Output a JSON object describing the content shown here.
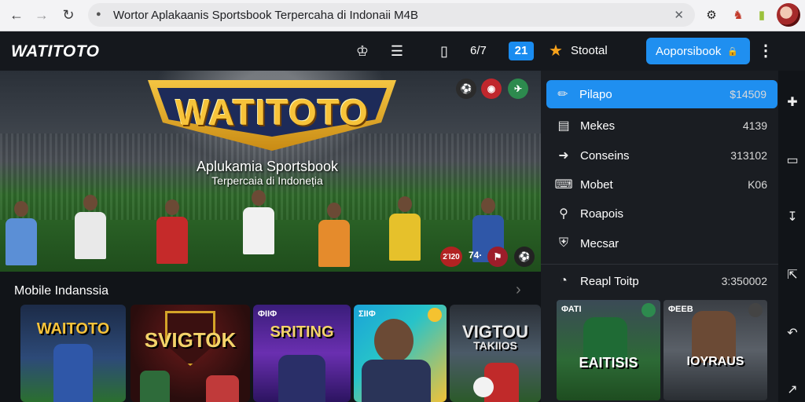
{
  "browser": {
    "url": "Wortor Aplakaanis Sportsbook Terpercaha di Indonaii M4B"
  },
  "header": {
    "brand": "WATITOTO",
    "counter": "6/7",
    "badge": "21",
    "stotal_label": "Stootal",
    "main_button_label": "Aoporsibook"
  },
  "hero": {
    "logo_text": "WATITOTO",
    "subtitle": "Aplukamia Sportsbook",
    "subtitle2": "Terpercaia di Indoneția",
    "score_left": "2Ί20",
    "score_right": "74·"
  },
  "section": {
    "title": "Mobile Indanssia"
  },
  "cards": [
    {
      "title": "WAITOTO"
    },
    {
      "title": "SVIGTOK"
    },
    {
      "title": "SRITING",
      "tag": "ΦΙΙΦ"
    },
    {
      "title": "",
      "tag": "ΣΙΙΦ"
    },
    {
      "title": "VIGTOU",
      "title2": "TAKIIOS"
    }
  ],
  "sidebar": {
    "items": [
      {
        "label": "Pilapo",
        "value": "$14509"
      },
      {
        "label": "Mekes",
        "value": "4139"
      },
      {
        "label": "Conseins",
        "value": "313102"
      },
      {
        "label": "Mobet",
        "value": "K06"
      },
      {
        "label": "Roapois",
        "value": ""
      },
      {
        "label": "Mecsar",
        "value": ""
      }
    ],
    "footer_label": "Reapl Toitp",
    "footer_value": "3:350002",
    "cards": [
      {
        "title": "EAITISIS",
        "tag": "ΦΑΤΙ"
      },
      {
        "title": "IOYRAUS",
        "tag": "ΦΕΕΒ"
      }
    ]
  },
  "colors": {
    "accent": "#1f8ff0",
    "gold": "#f7c33a",
    "background": "#111418"
  }
}
